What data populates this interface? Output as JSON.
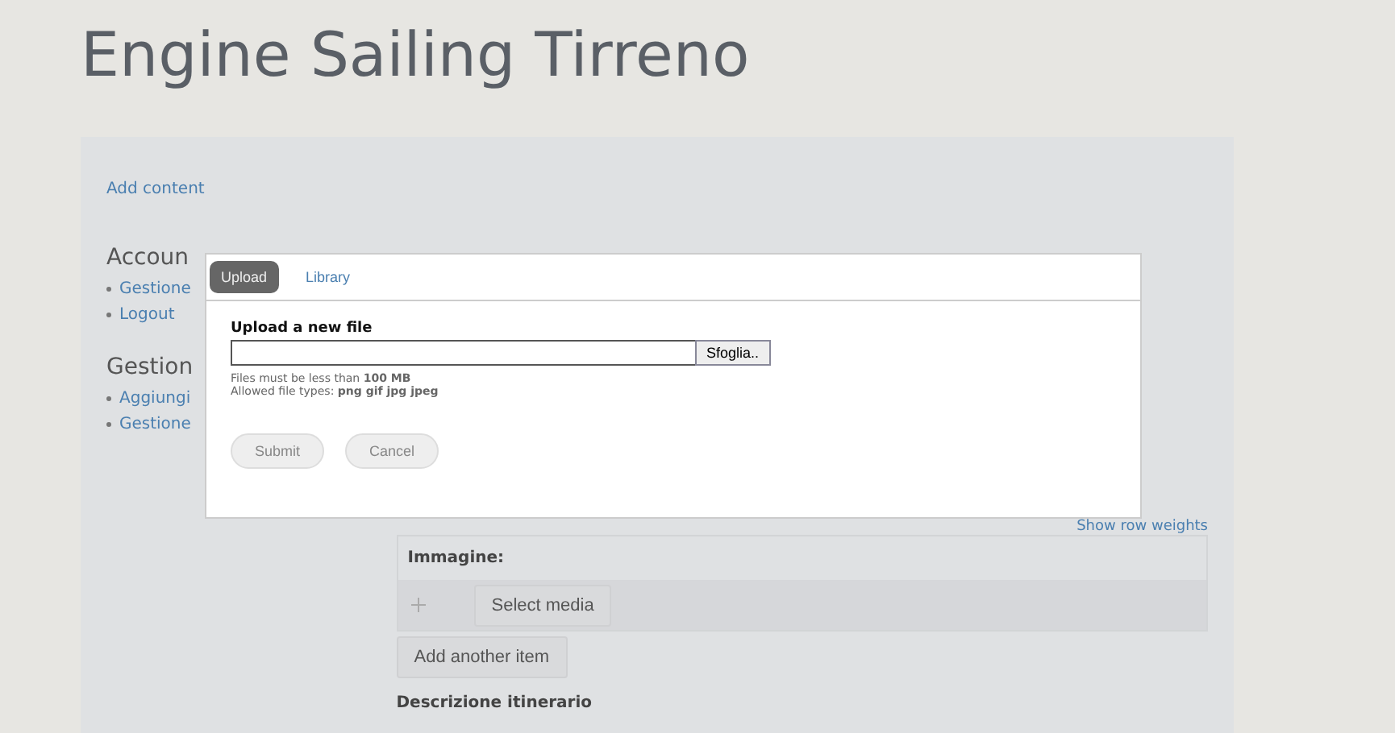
{
  "site_title": "Engine Sailing Tirreno",
  "add_content": "Add content",
  "sidebar": [
    {
      "heading": "Accoun",
      "items": [
        "Gestione",
        "Logout"
      ]
    },
    {
      "heading": "Gestion",
      "items": [
        "Aggiungi",
        "Gestione"
      ]
    }
  ],
  "main": {
    "row_weights_link": "Show row weights",
    "field_label": "Immagine:",
    "select_button": "Select media",
    "add_button": "Add another item",
    "next_label": "Descrizione itinerario"
  },
  "dialog": {
    "tabs": [
      {
        "label": "Upload",
        "selected": true
      },
      {
        "label": "Library",
        "selected": false
      }
    ],
    "upload_label": "Upload a new file",
    "browse_button": "Sfoglia..",
    "hints": [
      "Files must be less than **100 MB**",
      "Allowed file types: **png gif jpg jpeg**"
    ],
    "buttons": [
      "Submit",
      "Cancel"
    ]
  }
}
